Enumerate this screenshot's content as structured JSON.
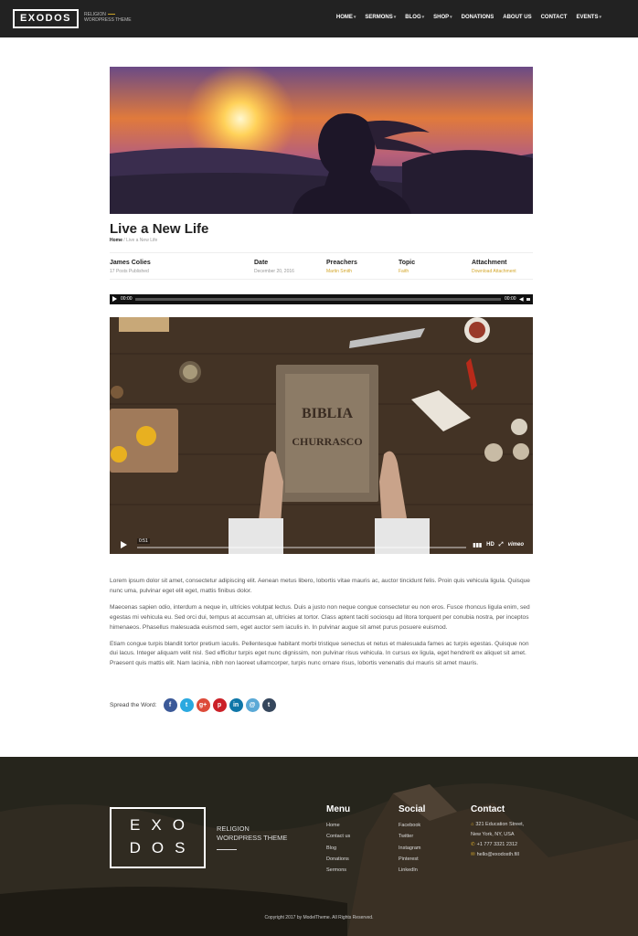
{
  "header": {
    "logo": "EXODOS",
    "tagline_1": "RELIGION",
    "tagline_2": "WORDPRESS THEME",
    "nav": [
      {
        "label": "HOME",
        "caret": "▾"
      },
      {
        "label": "SERMONS",
        "caret": "▾"
      },
      {
        "label": "BLOG",
        "caret": "▾"
      },
      {
        "label": "SHOP",
        "caret": "▾"
      },
      {
        "label": "DONATIONS",
        "caret": ""
      },
      {
        "label": "ABOUT US",
        "caret": ""
      },
      {
        "label": "CONTACT",
        "caret": ""
      },
      {
        "label": "EVENTS",
        "caret": "▾"
      }
    ]
  },
  "page": {
    "title": "Live a New Life",
    "breadcrumb": {
      "home": "Home",
      "sep": "/",
      "current": "Live a New Life"
    }
  },
  "meta": {
    "author": {
      "name": "James Colies",
      "posts": "17 Posts Published"
    },
    "date": {
      "label": "Date",
      "value": "December 20, 2016"
    },
    "preachers": {
      "label": "Preachers",
      "value": "Martin Smith"
    },
    "topic": {
      "label": "Topic",
      "value": "Faith"
    },
    "attachment": {
      "label": "Attachment",
      "value": "Download Attachment"
    }
  },
  "audio": {
    "current": "00:00",
    "duration": "00:00"
  },
  "video": {
    "time": "0:51",
    "hd": "HD",
    "brand": "vimeo"
  },
  "body": {
    "paragraphs": [
      "Lorem ipsum dolor sit amet, consectetur adipiscing elit. Aenean metus libero, lobortis vitae mauris ac, auctor tincidunt felis. Proin quis vehicula ligula. Quisque nunc uma, pulvinar eget elit eget, mattis finibus dolor.",
      "Maecenas sapien odio, interdum a neque in, ultricies volutpat lectus. Duis a justo non neque congue consectetur eu non eros. Fusce rhoncus ligula enim, sed egestas mi vehicula eu. Sed orci dui, tempus at accumsan at, ultricies at tortor. Class aptent taciti sociosqu ad litora torquent per conubia nostra, per inceptos himenaeos. Phasellus malesuada euismod sem, eget auctor sem iaculis in. In pulvinar augue sit amet purus posuere euismod.",
      "Etiam congue turpis blandit tortor pretium iaculis. Pellentesque habitant morbi tristique senectus et netus et malesuada fames ac turpis egestas. Quisque non dui lacus. Integer aliquam velit nisl. Sed efficitur turpis eget nunc dignissim, non pulvinar risus vehicula. In cursus ex ligula, eget hendrerit ex aliquet sit amet. Praesent quis mattis elit. Nam lacinia, nibh non laoreet ullamcorper, turpis nunc ornare risus, lobortis venenatis dui mauris sit amet mauris."
    ],
    "share_label": "Spread the Word:",
    "share_icons": [
      {
        "name": "facebook-icon",
        "glyph": "f",
        "color": "#3b5998"
      },
      {
        "name": "twitter-icon",
        "glyph": "t",
        "color": "#2aa9e0"
      },
      {
        "name": "google-plus-icon",
        "glyph": "g+",
        "color": "#dd4b39"
      },
      {
        "name": "pinterest-icon",
        "glyph": "p",
        "color": "#cb2027"
      },
      {
        "name": "linkedin-icon",
        "glyph": "in",
        "color": "#0e76a8"
      },
      {
        "name": "email-icon",
        "glyph": "@",
        "color": "#5aa9d6"
      },
      {
        "name": "tumblr-icon",
        "glyph": "t",
        "color": "#35465c"
      }
    ]
  },
  "footer": {
    "logo_line1": "EXO",
    "logo_line2": "DOS",
    "tagline_1": "RELIGION",
    "tagline_2": "WORDPRESS THEME",
    "menu": {
      "heading": "Menu",
      "items": [
        "Home",
        "Contact us",
        "Blog",
        "Donations",
        "Sermons"
      ]
    },
    "social": {
      "heading": "Social",
      "items": [
        "Facebook",
        "Twitter",
        "Instagram",
        "Pinterest",
        "LinkedIn"
      ]
    },
    "contact": {
      "heading": "Contact",
      "address_1": "321 Education Street,",
      "address_2": "New York, NY, USA",
      "phone": "+1 777 3321 2312",
      "email": "hello@exodosth.fill"
    },
    "copyright": "Copyright 2017 by ModelTheme. All Rights Reserved."
  }
}
